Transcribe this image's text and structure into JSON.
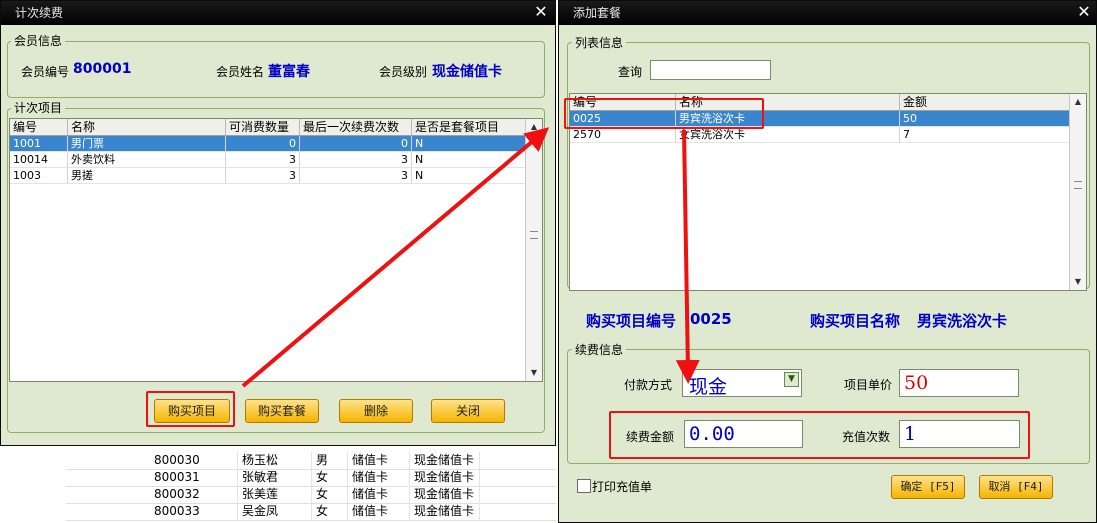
{
  "background_table": {
    "rows": [
      {
        "id": "800030",
        "name": "杨玉松",
        "gender": "男",
        "type": "储值卡",
        "level": "现金储值卡"
      },
      {
        "id": "800031",
        "name": "张敏君",
        "gender": "女",
        "type": "储值卡",
        "level": "现金储值卡"
      },
      {
        "id": "800032",
        "name": "张美莲",
        "gender": "女",
        "type": "储值卡",
        "level": "现金储值卡"
      },
      {
        "id": "800033",
        "name": "吴金凤",
        "gender": "女",
        "type": "储值卡",
        "level": "现金储值卡"
      }
    ]
  },
  "left_window": {
    "title": "计次续费",
    "member_group_label": "会员信息",
    "member_no_label": "会员编号",
    "member_no": "800001",
    "member_name_label": "会员姓名",
    "member_name": "董富春",
    "member_level_label": "会员级别",
    "member_level": "现金储值卡",
    "items_group_label": "计次项目",
    "columns": [
      "编号",
      "名称",
      "可消费数量",
      "最后一次续费次数",
      "是否是套餐项目"
    ],
    "rows": [
      {
        "id": "1001",
        "name": "男门票",
        "qty": "0",
        "last": "0",
        "pkg": "N"
      },
      {
        "id": "10014",
        "name": "外卖饮料",
        "qty": "3",
        "last": "3",
        "pkg": "N"
      },
      {
        "id": "1003",
        "name": "男搓",
        "qty": "3",
        "last": "3",
        "pkg": "N"
      }
    ],
    "buttons": {
      "buy_item": "购买项目",
      "buy_package": "购买套餐",
      "delete": "删除",
      "close": "关闭"
    }
  },
  "right_window": {
    "title": "添加套餐",
    "list_group_label": "列表信息",
    "query_label": "查询",
    "query_value": "",
    "columns": [
      "编号",
      "名称",
      "金额"
    ],
    "rows": [
      {
        "id": "0025",
        "name": "男宾洗浴次卡",
        "amount": "50"
      },
      {
        "id": "2570",
        "name": "女宾洗浴次卡",
        "amount": "7"
      }
    ],
    "purchase_id_label": "购买项目编号",
    "purchase_id": "0025",
    "purchase_name_label": "购买项目名称",
    "purchase_name": "男宾洗浴次卡",
    "renew_group_label": "续费信息",
    "payment_label": "付款方式",
    "payment_value": "现金",
    "unit_price_label": "项目单价",
    "unit_price": "50",
    "renew_amount_label": "续费金额",
    "renew_amount": "0.00",
    "recharge_times_label": "充值次数",
    "recharge_times": "1",
    "print_label": "打印充值单",
    "ok_button": "确定 [F5]",
    "cancel_button": "取消 [F4]"
  },
  "colors": {
    "accent_blue": "#0000c8",
    "value_red": "#e00000",
    "annotation_red": "#f01010",
    "selection": "#3a86ce",
    "panel": "#dfe9cf"
  }
}
